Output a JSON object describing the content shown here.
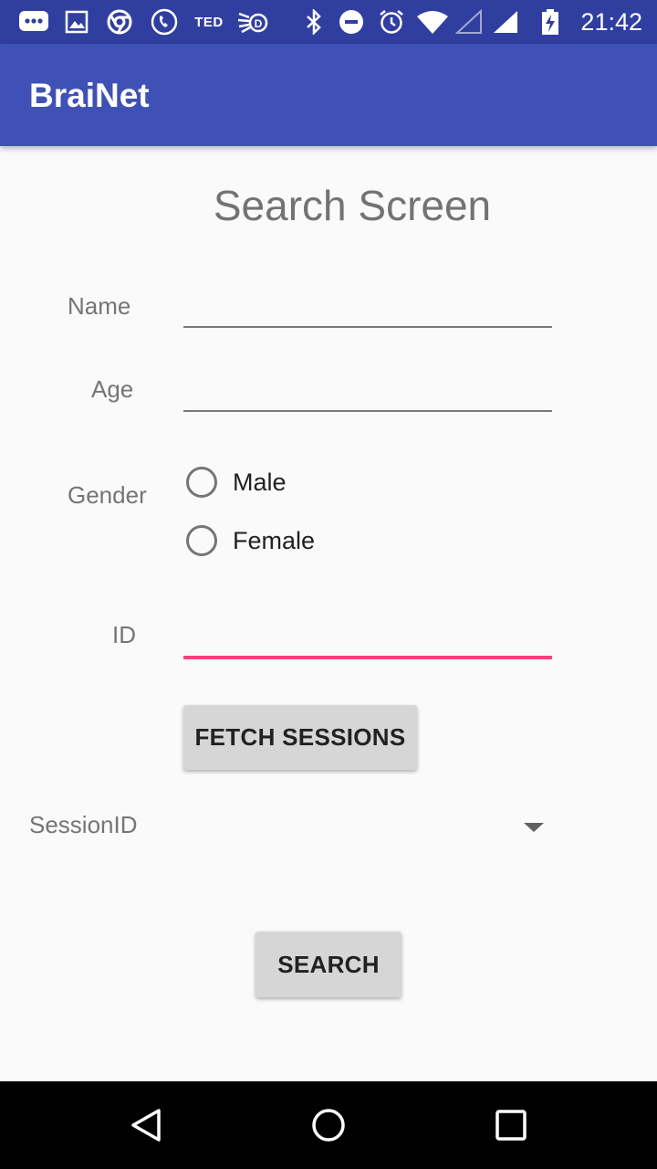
{
  "status_bar": {
    "time": "21:42",
    "ted_label": "TED",
    "icons": [
      "messages-icon",
      "gallery-icon",
      "chrome-icon",
      "phone-icon",
      "ted-icon",
      "app-icon",
      "bluetooth-icon",
      "do-not-disturb-icon",
      "alarm-icon",
      "wifi-icon",
      "signal-empty-icon",
      "signal-icon",
      "battery-charging-icon"
    ]
  },
  "app_bar": {
    "title": "BraiNet"
  },
  "screen": {
    "title": "Search Screen"
  },
  "form": {
    "name_label": "Name",
    "name_value": "",
    "age_label": "Age",
    "age_value": "",
    "gender_label": "Gender",
    "gender_options": [
      "Male",
      "Female"
    ],
    "id_label": "ID",
    "id_value": "",
    "fetch_button": "FETCH SESSIONS",
    "session_label": "SessionID",
    "session_value": "",
    "search_button": "SEARCH"
  },
  "colors": {
    "primary": "#3f51b5",
    "primary_dark": "#303f9f",
    "accent": "#ff4081"
  },
  "nav_bar": {
    "icons": [
      "back-icon",
      "home-icon",
      "recents-icon"
    ]
  }
}
